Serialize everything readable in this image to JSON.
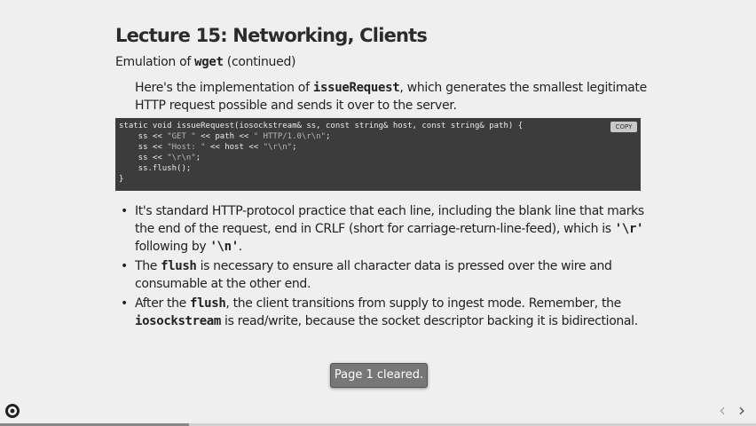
{
  "title": "Lecture 15: Networking, Clients",
  "subtitle": {
    "prefix": "Emulation of ",
    "code": "wget",
    "suffix": " (continued)"
  },
  "intro": {
    "prefix": "Here's the implementation of ",
    "code": "issueRequest",
    "suffix": ", which generates the smallest legitimate HTTP request possible and sends it over to the server."
  },
  "code_block": {
    "copy_label": "COPY",
    "lines": [
      [
        {
          "t": "static void issueRequest(iosockstream& ss, const string& host, const string& path) {"
        }
      ],
      [
        {
          "t": "    ss << "
        },
        {
          "t": "\"GET \"",
          "s": 1
        },
        {
          "t": " << path << "
        },
        {
          "t": "\" HTTP/1.0\\r\\n\"",
          "s": 1
        },
        {
          "t": ";"
        }
      ],
      [
        {
          "t": "    ss << "
        },
        {
          "t": "\"Host: \"",
          "s": 1
        },
        {
          "t": " << host << "
        },
        {
          "t": "\"\\r\\n\"",
          "s": 1
        },
        {
          "t": ";"
        }
      ],
      [
        {
          "t": "    ss << "
        },
        {
          "t": "\"\\r\\n\"",
          "s": 1
        },
        {
          "t": ";"
        }
      ],
      [
        {
          "t": "    ss.flush();"
        }
      ],
      [
        {
          "t": "}"
        }
      ]
    ]
  },
  "bullets": [
    [
      {
        "t": "It's standard HTTP-protocol practice that each line, including the blank line that marks the end of the request, end in CRLF (short for carriage-return-line-feed), which is "
      },
      {
        "c": "'\\r'"
      },
      {
        "t": " following by "
      },
      {
        "c": "'\\n'"
      },
      {
        "t": "."
      }
    ],
    [
      {
        "t": "The "
      },
      {
        "c": "flush"
      },
      {
        "t": " is necessary to ensure all character data is pressed over the wire and consumable at the other end."
      }
    ],
    [
      {
        "t": "After the "
      },
      {
        "c": "flush"
      },
      {
        "t": ", the client transitions from supply to ingest mode. Remember, the "
      },
      {
        "c": "iosockstream"
      },
      {
        "t": " is read/write, because the socket descriptor backing it is bidirectional."
      }
    ]
  ],
  "toast": "Page 1 cleared.",
  "nav": {
    "prev": "‹",
    "next": "›"
  },
  "progress": 0.25,
  "icons": {
    "logo": "slides-logo-icon",
    "prev": "chevron-left-icon",
    "next": "chevron-right-icon"
  }
}
